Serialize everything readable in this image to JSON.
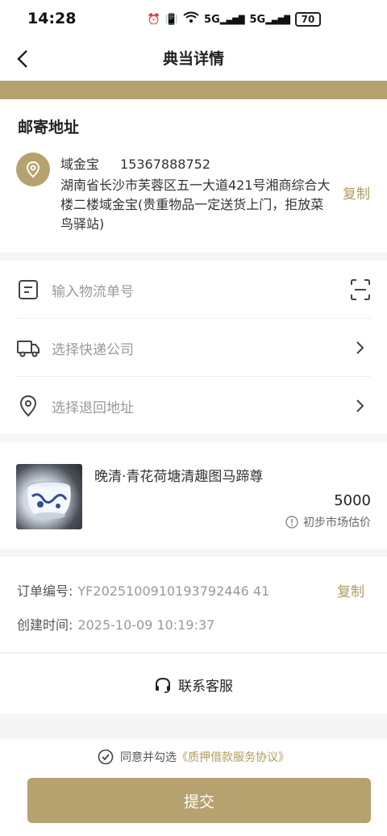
{
  "status_bar": {
    "time": "14:28",
    "battery": "70",
    "network1": "5G",
    "network2": "5G"
  },
  "nav": {
    "title": "典当详情"
  },
  "address": {
    "section_title": "邮寄地址",
    "name": "域金宝",
    "phone": "15367888752",
    "detail": "湖南省长沙市芙蓉区五一大道421号湘商综合大楼二楼域金宝(贵重物品一定送货上门，拒放菜鸟驿站)",
    "copy_label": "复制"
  },
  "logistics": {
    "tracking_placeholder": "输入物流单号",
    "courier_placeholder": "选择快递公司",
    "return_address_placeholder": "选择退回地址"
  },
  "goods": {
    "name": "晚清·青花荷塘清趣图马蹄尊",
    "price": "5000",
    "price_hint": "初步市场估价"
  },
  "order": {
    "number_label": "订单编号:",
    "number_value": "YF2025100910193792446 41",
    "created_label": "创建时间:",
    "created_value": "2025-10-09 10:19:37",
    "copy_label": "复制"
  },
  "service": {
    "label": "联系客服"
  },
  "bottom": {
    "agree_text": "同意并勾选",
    "agreement_link": "《质押借款服务协议》",
    "submit_label": "提交"
  },
  "colors": {
    "accent": "#b5a26e",
    "accent_text": "#b09a5e"
  }
}
